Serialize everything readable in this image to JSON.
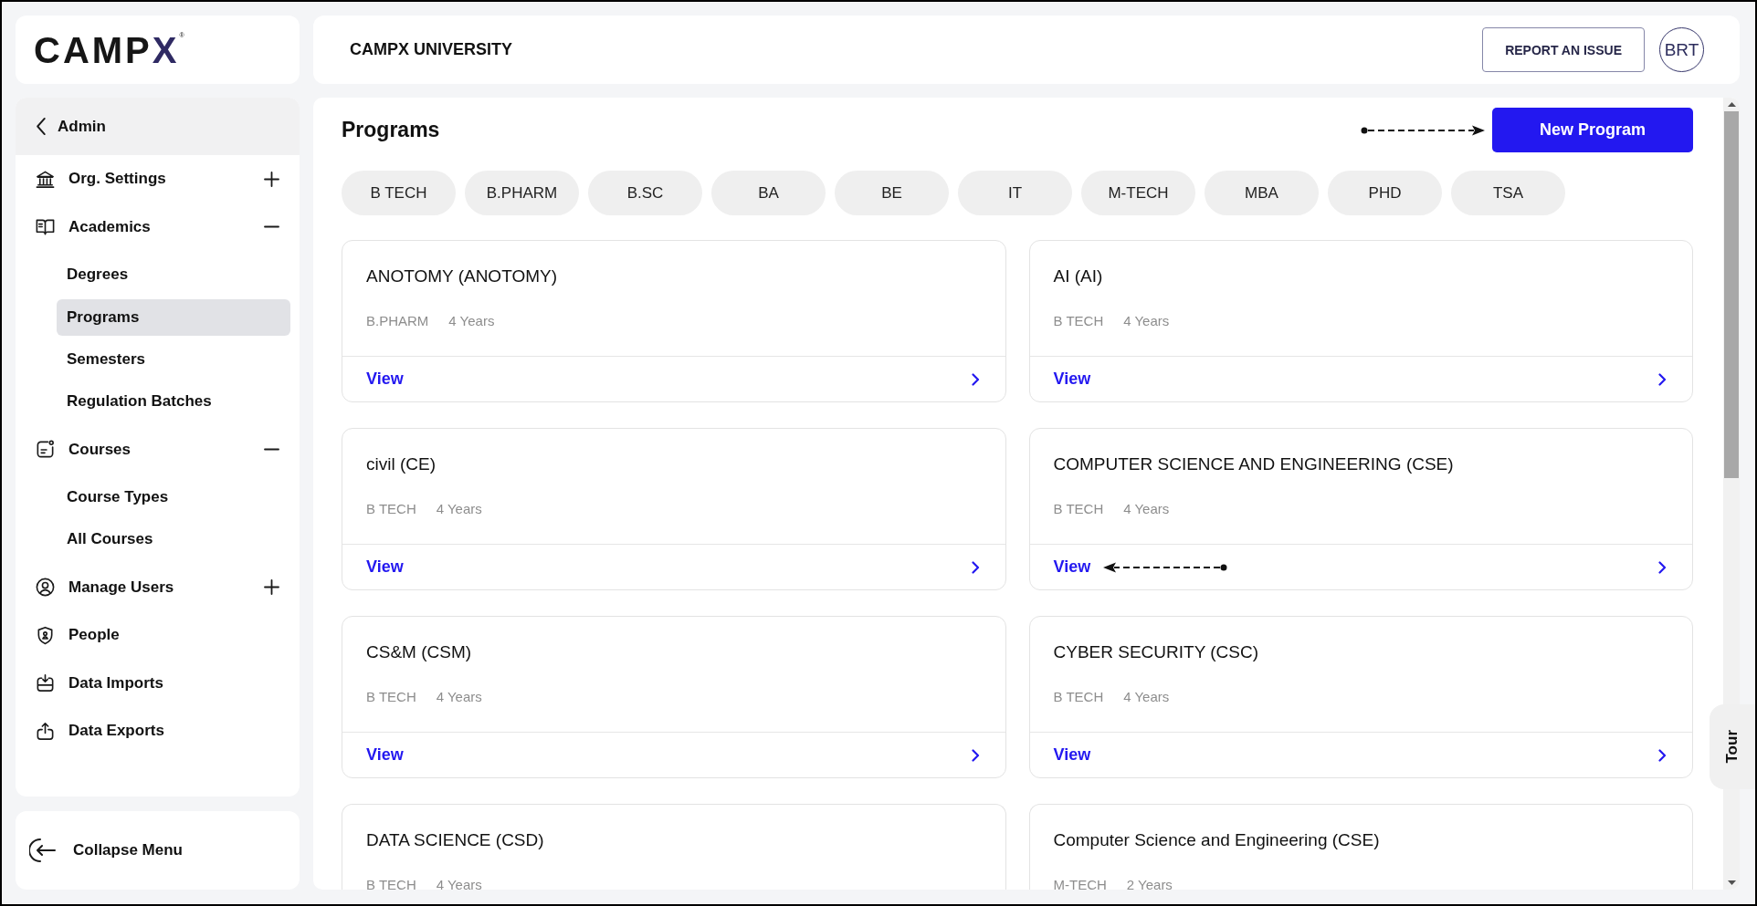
{
  "logo": {
    "text": "CAMP",
    "accent": "X",
    "mark": "®"
  },
  "nav": {
    "back": "Admin",
    "items": [
      {
        "kind": "group",
        "label": "Org. Settings",
        "expanded": false
      },
      {
        "kind": "group",
        "label": "Academics",
        "expanded": true,
        "children": [
          {
            "label": "Degrees",
            "selected": false
          },
          {
            "label": "Programs",
            "selected": true
          },
          {
            "label": "Semesters",
            "selected": false
          },
          {
            "label": "Regulation Batches",
            "selected": false
          }
        ]
      },
      {
        "kind": "group",
        "label": "Courses",
        "expanded": true,
        "children": [
          {
            "label": "Course Types",
            "selected": false
          },
          {
            "label": "All Courses",
            "selected": false
          }
        ]
      },
      {
        "kind": "group",
        "label": "Manage Users",
        "expanded": false
      },
      {
        "kind": "link",
        "label": "People"
      },
      {
        "kind": "link",
        "label": "Data Imports"
      },
      {
        "kind": "link",
        "label": "Data Exports"
      }
    ]
  },
  "collapse": {
    "label": "Collapse Menu"
  },
  "header": {
    "title": "CAMPX UNIVERSITY",
    "report_button": "REPORT AN ISSUE",
    "avatar": "BRT"
  },
  "main": {
    "title": "Programs",
    "new_button": {
      "label": "New Program",
      "pointer_arrow": true
    },
    "filters": [
      "B TECH",
      "B.PHARM",
      "B.SC",
      "BA",
      "BE",
      "IT",
      "M-TECH",
      "MBA",
      "PHD",
      "TSA"
    ],
    "programs": [
      {
        "title": "ANOTOMY (ANOTOMY)",
        "degree": "B.PHARM",
        "duration": "4 Years",
        "link": "View",
        "pointer_arrow": false
      },
      {
        "title": "AI (AI)",
        "degree": "B TECH",
        "duration": "4 Years",
        "link": "View",
        "pointer_arrow": false
      },
      {
        "title": "civil (CE)",
        "degree": "B TECH",
        "duration": "4 Years",
        "link": "View",
        "pointer_arrow": false
      },
      {
        "title": "COMPUTER SCIENCE AND ENGINEERING (CSE)",
        "degree": "B TECH",
        "duration": "4 Years",
        "link": "View",
        "pointer_arrow": true
      },
      {
        "title": "CS&M (CSM)",
        "degree": "B TECH",
        "duration": "4 Years",
        "link": "View",
        "pointer_arrow": false
      },
      {
        "title": "CYBER SECURITY (CSC)",
        "degree": "B TECH",
        "duration": "4 Years",
        "link": "View",
        "pointer_arrow": false
      },
      {
        "title": "DATA SCIENCE (CSD)",
        "degree": "B TECH",
        "duration": "4 Years",
        "pointer_arrow": false
      },
      {
        "title": "Computer Science and Engineering (CSE)",
        "degree": "M-TECH",
        "duration": "2 Years",
        "pointer_arrow": false
      }
    ]
  },
  "tour": "Tour"
}
